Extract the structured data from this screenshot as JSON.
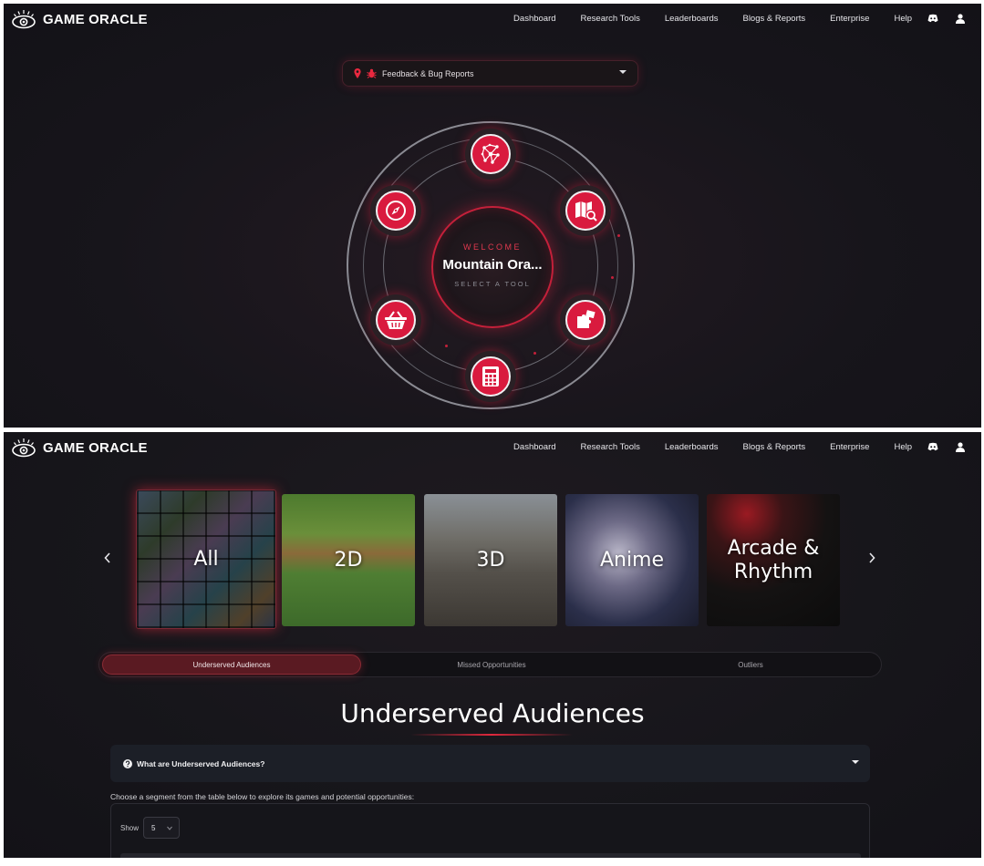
{
  "brand": {
    "name": "GAME ORACLE",
    "logo_icon": "eye-logo-icon"
  },
  "nav": {
    "links": [
      "Dashboard",
      "Research Tools",
      "Leaderboards",
      "Blogs & Reports",
      "Enterprise",
      "Help"
    ],
    "icons": [
      "discord-icon",
      "user-icon"
    ]
  },
  "feedback": {
    "label": "Feedback & Bug Reports",
    "icons": [
      "pin-icon",
      "bug-icon"
    ]
  },
  "wheel": {
    "welcome": "WELCOME",
    "user_name": "Mountain Ora...",
    "subtitle": "SELECT A TOOL",
    "tools": [
      "network-graph-icon",
      "map-search-icon",
      "puzzle-icon",
      "calculator-icon",
      "basket-icon",
      "compass-icon"
    ]
  },
  "categories": [
    {
      "label": "All",
      "selected": true
    },
    {
      "label": "2D"
    },
    {
      "label": "3D"
    },
    {
      "label": "Anime"
    },
    {
      "label": "Arcade & Rhythm"
    }
  ],
  "tabs": [
    {
      "label": "Underserved Audiences",
      "active": true
    },
    {
      "label": "Missed Opportunities"
    },
    {
      "label": "Outliers"
    }
  ],
  "section": {
    "title": "Underserved Audiences",
    "faq_question": "What are Underserved Audiences?",
    "helper_text": "Choose a segment from the table below to explore its games and potential opportunities:"
  },
  "table_controls": {
    "show_label": "Show",
    "page_size": "5"
  },
  "colors": {
    "accent": "#d91a3e",
    "background": "#15141a",
    "tab_active": "#5a1a22"
  }
}
